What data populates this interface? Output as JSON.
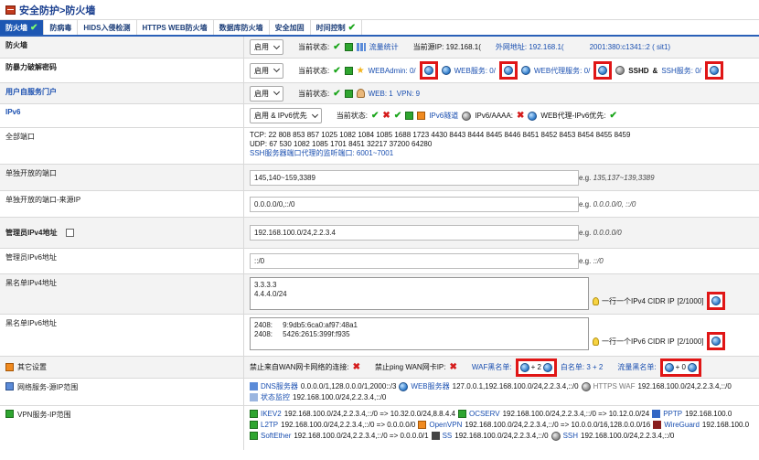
{
  "title": "安全防护>防火墙",
  "tabs": [
    {
      "label": "防火墙",
      "active": true,
      "checked": true
    },
    {
      "label": "防病毒"
    },
    {
      "label": "HIDS入侵检测"
    },
    {
      "label": "HTTPS WEB防火墙"
    },
    {
      "label": "数据库防火墙"
    },
    {
      "label": "安全加固"
    },
    {
      "label": "时间控制",
      "checked": true
    }
  ],
  "firewall": {
    "label": "防火墙",
    "select": "启用",
    "status_label": "当前状态:",
    "traffic_stats": "流量统计",
    "source_ip": "当前源IP: 192.168.1(",
    "external": "外网地址: 192.168.1(",
    "ipv6_addr": "2001:380:c1341::2 ( sit1)"
  },
  "bruteforce": {
    "label": "防暴力破解密码",
    "select": "启用",
    "status_label": "当前状态:",
    "webadmin": "WEBAdmin: 0/",
    "webservice": "WEB服务: 0/",
    "webproxy": "WEB代理服务: 0/",
    "sshd": "SSHD",
    "ssh_amp": "&",
    "ssh_service": "SSH服务: 0/"
  },
  "portal": {
    "label": "用户自服务门户",
    "select": "启用",
    "status_label": "当前状态:",
    "web": "WEB: 1",
    "vpn": "VPN: 9"
  },
  "ipv6": {
    "label": "IPv6",
    "select": "启用 & IPv6优先",
    "status_label": "当前状态:",
    "tunnel": "IPv6隧道",
    "aaaa": "IPv6/AAAA:",
    "webproxy": "WEB代理-IPv6优先:"
  },
  "all_ports": {
    "label": "全部端口",
    "tcp": "TCP: 22 808 853 857 1025 1082 1084 1085 1688 1723 4430 8443 8444 8445 8446 8451 8452 8453 8454 8455 8459",
    "udp": "UDP: 67 530 1082 1085 1701 8451 32217 37200 64280",
    "ssh_proxy": "SSH服务器端口代理的监听端口: 6001~7001"
  },
  "open_ports": {
    "label": "单独开放的端口",
    "value": "145,140~159,3389",
    "eg_prefix": "e.g.",
    "eg": "135,137~139,3389"
  },
  "open_ports_src": {
    "label": "单独开放的端口-来源IP",
    "value": "0.0.0.0/0,::/0",
    "eg_prefix": "e.g.",
    "eg": "0.0.0.0/0, ::/0"
  },
  "admin_ipv4": {
    "label": "管理员IPv4地址",
    "value": "192.168.100.0/24,2.2.3.4",
    "eg_prefix": "e.g.",
    "eg": "0.0.0.0/0"
  },
  "admin_ipv6": {
    "label": "管理员IPv6地址",
    "value": "::/0",
    "eg_prefix": "e.g.",
    "eg": "::/0"
  },
  "blacklist_ipv4": {
    "label": "黑名单IPv4地址",
    "value": "3.3.3.3\n4.4.4.0/24",
    "hint": "一行一个IPv4 CIDR IP",
    "count": "[2/1000]"
  },
  "blacklist_ipv6": {
    "label": "黑名单IPv6地址",
    "value": "2408:     9:9db5:6ca0:af97:48a1\n2408:     5426:2615:399f:f935",
    "hint": "一行一个IPv6 CIDR IP",
    "count": "[2/1000]"
  },
  "other": {
    "label": "其它设置",
    "wan_block": "禁止来自WAN网卡网络的连接:",
    "ping_block": "禁止ping WAN网卡IP:",
    "waf": "WAF黑名单:",
    "waf_count": "+ 2",
    "whitelist": "白名单: 3 + 2",
    "traffic_black": "流量黑名单:",
    "traffic_count": "+ 0"
  },
  "netservice": {
    "label": "网络服务-源IP范围",
    "dns": "DNS服务器",
    "dns_val": "0.0.0.0/1,128.0.0.0/1,2000::/3",
    "web": "WEB服务器",
    "web_val": "127.0.0.1,192.168.100.0/24,2.2.3.4,::/0",
    "httpswaf": "HTTPS WAF",
    "httpswaf_val": "192.168.100.0/24,2.2.3.4,::/0",
    "status": "状态监控",
    "status_val": "192.168.100.0/24,2.2.3.4,::/0"
  },
  "vpn": {
    "label": "VPN服务-IP范围",
    "ikev2": "IKEV2",
    "ikev2_val": "192.168.100.0/24,2.2.3.4,::/0 => 10.32.0.0/24,8.8.4.4",
    "ocserv": "OCSERV",
    "ocserv_val": "192.168.100.0/24,2.2.3.4,::/0 => 10.12.0.0/24",
    "pptp": "PPTP",
    "pptp_val": "192.168.100.0",
    "l2tp": "L2TP",
    "l2tp_val": "192.168.100.0/24,2.2.3.4,::/0 => 0.0.0.0/0",
    "openvpn": "OpenVPN",
    "openvpn_val": "192.168.100.0/24,2.2.3.4,::/0 => 10.0.0.0/16,128.0.0.0/16",
    "wireguard": "WireGuard",
    "wireguard_val": "192.168.100.0",
    "softether": "SoftEther",
    "softether_val": "192.168.100.0/24,2.2.3.4,::/0 => 0.0.0.0/1",
    "ss": "SS",
    "ss_val": "192.168.100.0/24,2.2.3.4,::/0",
    "ssh": "SSH",
    "ssh_val": "192.168.100.0/24,2.2.3.4,::/0"
  }
}
